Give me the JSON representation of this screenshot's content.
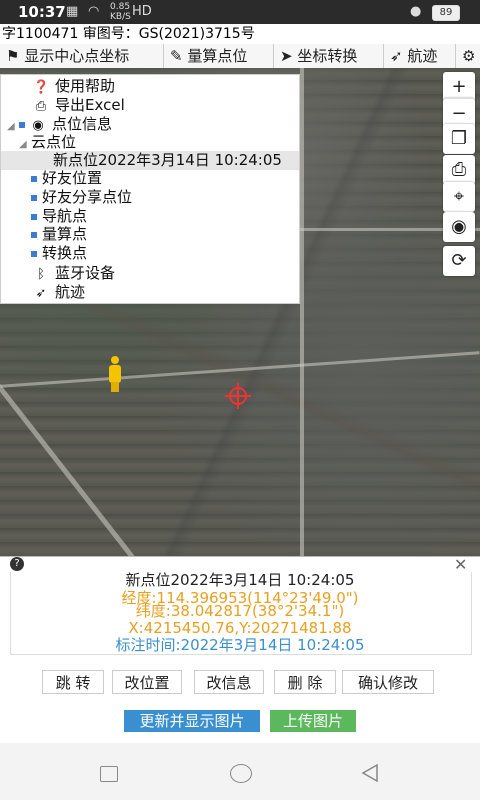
{
  "statusbar": {
    "time": "10:37",
    "net_speed": "0.85",
    "net_unit": "KB/S",
    "battery": "89"
  },
  "top_line": "字1100471 审图号：GS(2021)3715号",
  "toolbar": [
    {
      "label": "显示中心点坐标",
      "icon": "flag-icon",
      "glyph": "⚑"
    },
    {
      "label": "量算点位",
      "icon": "edit-icon",
      "glyph": "✎"
    },
    {
      "label": "坐标转换",
      "icon": "send-icon",
      "glyph": "➤"
    },
    {
      "label": "航迹",
      "icon": "navigation-icon",
      "glyph": "➶"
    },
    {
      "label": "",
      "icon": "gear-icon",
      "glyph": "⚙"
    }
  ],
  "tree": {
    "items": [
      {
        "label": "使用帮助",
        "icon": "help-icon",
        "glyph": "❓"
      },
      {
        "label": "导出Excel",
        "icon": "print-icon",
        "glyph": "⎙"
      },
      {
        "label": "点位信息",
        "icon": "location-icon",
        "glyph": "◉"
      },
      {
        "label": "云点位"
      },
      {
        "label": "新点位2022年3月14日 10:24:05"
      },
      {
        "label": "好友位置"
      },
      {
        "label": "好友分享点位"
      },
      {
        "label": "导航点"
      },
      {
        "label": "量算点"
      },
      {
        "label": "转换点"
      },
      {
        "label": "蓝牙设备",
        "icon": "bluetooth-icon",
        "glyph": "ᛒ"
      },
      {
        "label": "航迹",
        "icon": "navigation-icon",
        "glyph": "➶"
      }
    ]
  },
  "map_controls": [
    {
      "name": "zoom-in-button",
      "glyph": "+"
    },
    {
      "name": "zoom-out-button",
      "glyph": "−"
    },
    {
      "name": "layers-button",
      "glyph": "❐"
    },
    {
      "name": "printer-button",
      "glyph": "⎙"
    },
    {
      "name": "locate-button",
      "glyph": "⌖"
    },
    {
      "name": "eye-button",
      "glyph": "◉"
    },
    {
      "name": "refresh-button",
      "glyph": "⟳"
    }
  ],
  "info": {
    "title": "新点位2022年3月14日 10:24:05",
    "longitude": "经度:114.396953(114°23'49.0\")",
    "latitude": "纬度:38.042817(38°2'34.1\")",
    "xy": "X:4215450.76,Y:20271481.88",
    "mark_time": "标注时间:2022年3月14日 10:24:05",
    "colors": {
      "longitude": "#e8a020",
      "latitude": "#e8a020",
      "xy": "#e8a020",
      "mark_time": "#3a8fd0"
    }
  },
  "actions": [
    "跳 转",
    "改位置",
    "改信息",
    "删 除",
    "确认修改"
  ],
  "buttons": {
    "refresh": {
      "label": "更新并显示图片",
      "color": "#3a8fd0"
    },
    "upload": {
      "label": "上传图片",
      "color": "#5cb85c"
    }
  }
}
